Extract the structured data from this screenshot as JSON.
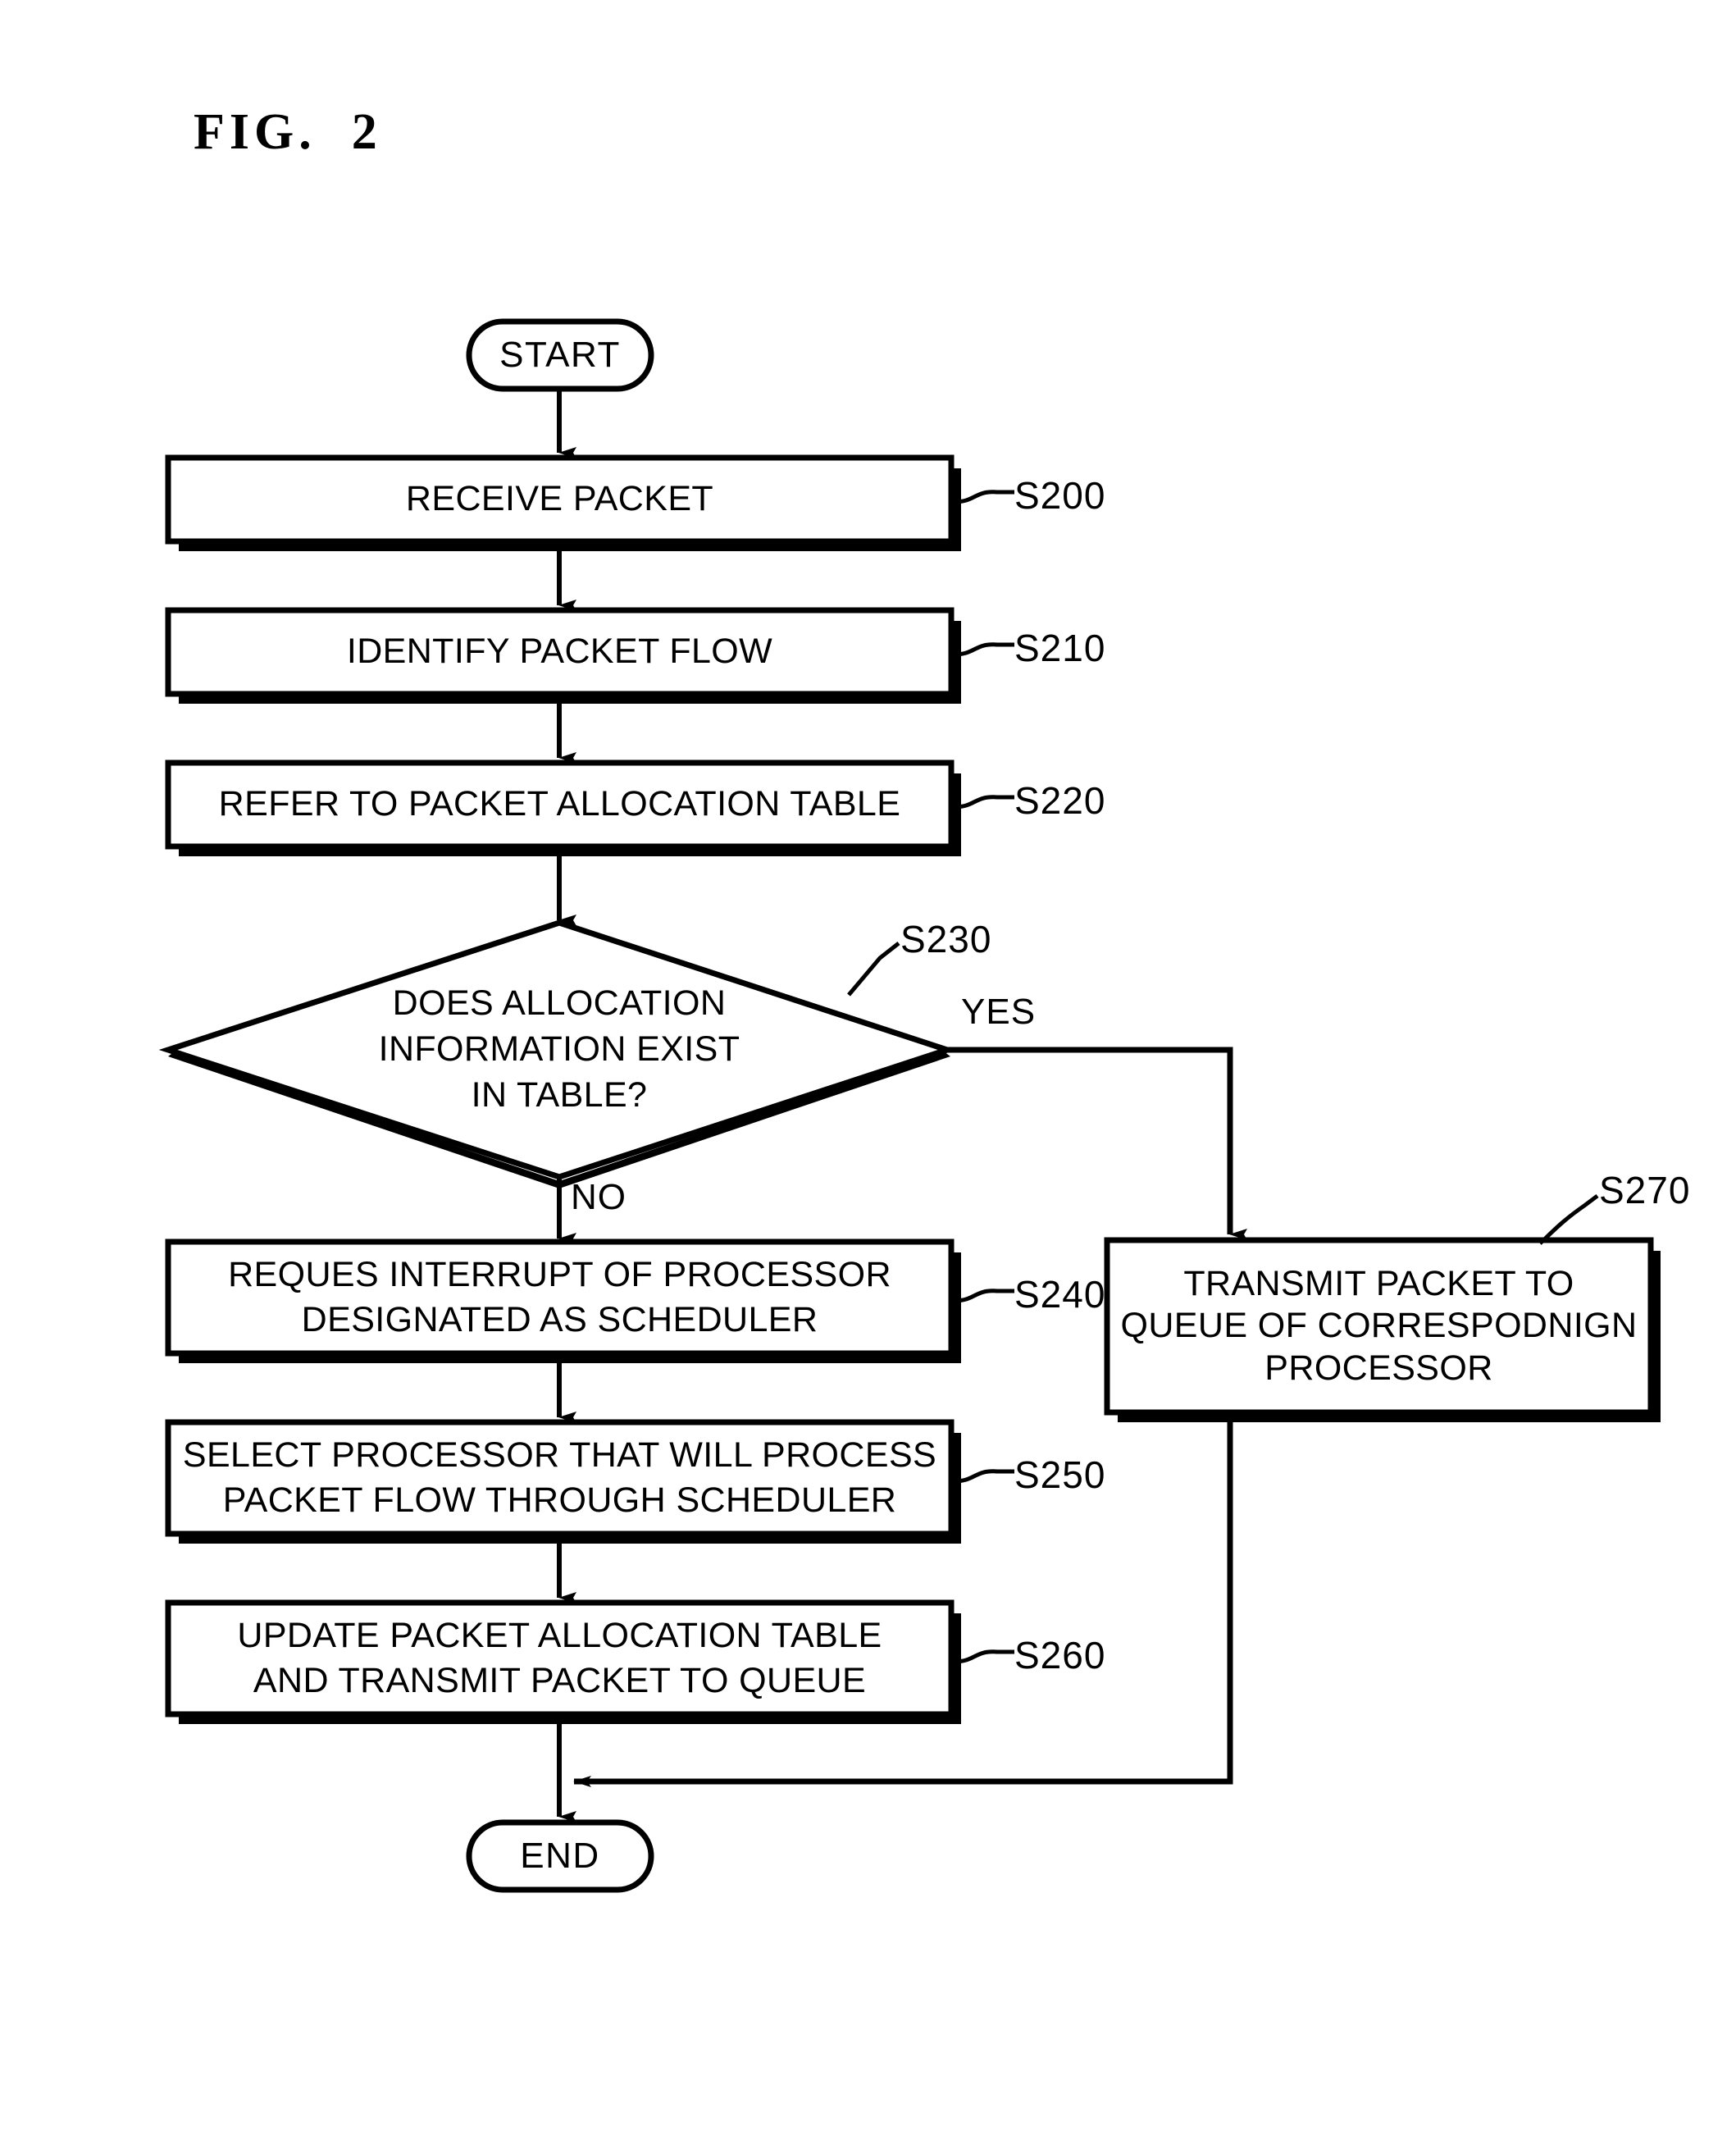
{
  "figure": {
    "title": "FIG.  2"
  },
  "colors": {
    "ink": "#000000",
    "paper": "#ffffff"
  },
  "nodes": {
    "start": {
      "label": "START",
      "shape": "terminator"
    },
    "s200": {
      "label": "RECEIVE PACKET",
      "ref": "S200",
      "shape": "process"
    },
    "s210": {
      "label": "IDENTIFY PACKET FLOW",
      "ref": "S210",
      "shape": "process"
    },
    "s220": {
      "label": "REFER TO PACKET ALLOCATION TABLE",
      "ref": "S220",
      "shape": "process"
    },
    "s230": {
      "line1": "DOES ALLOCATION",
      "line2": "INFORMATION EXIST",
      "line3": "IN TABLE?",
      "ref": "S230",
      "shape": "decision"
    },
    "s240": {
      "line1": "REQUES INTERRUPT OF PROCESSOR",
      "line2": "DESIGNATED AS SCHEDULER",
      "ref": "S240",
      "shape": "process"
    },
    "s250": {
      "line1": "SELECT PROCESSOR THAT WILL PROCESS",
      "line2": "PACKET FLOW THROUGH SCHEDULER",
      "ref": "S250",
      "shape": "process"
    },
    "s260": {
      "line1": "UPDATE PACKET ALLOCATION TABLE",
      "line2": "AND TRANSMIT PACKET TO QUEUE",
      "ref": "S260",
      "shape": "process"
    },
    "s270": {
      "line1": "TRANSMIT PACKET TO",
      "line2": "QUEUE OF CORRESPODNIGN",
      "line3": "PROCESSOR",
      "ref": "S270",
      "shape": "process"
    },
    "end": {
      "label": "END",
      "shape": "terminator"
    }
  },
  "branches": {
    "yes": "YES",
    "no": "NO"
  }
}
